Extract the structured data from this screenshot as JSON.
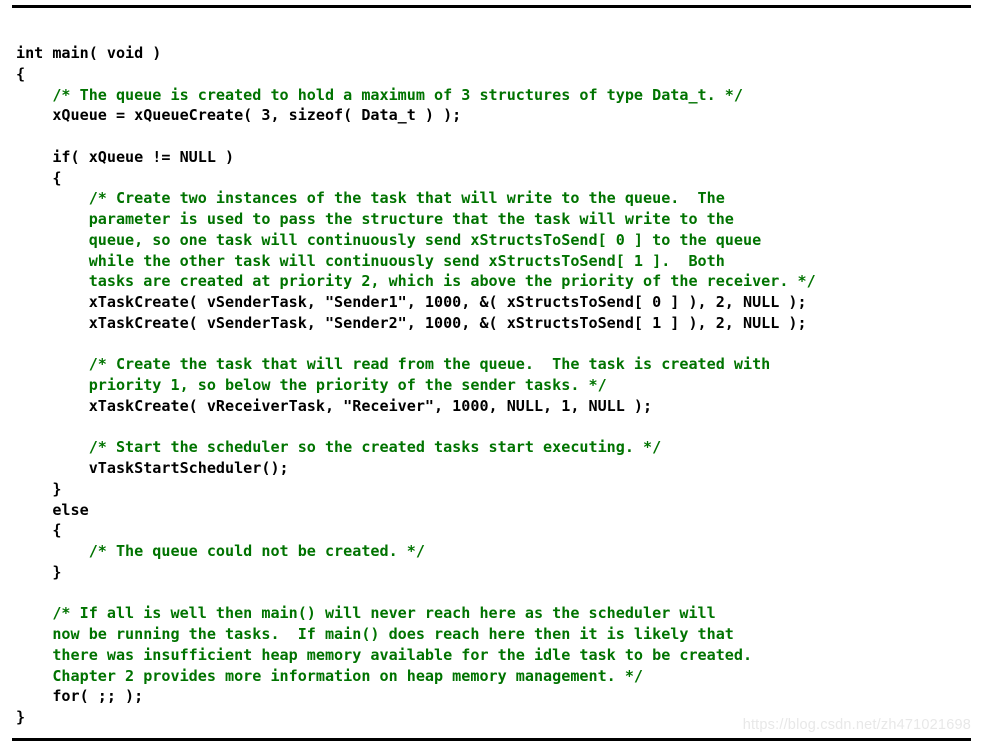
{
  "document": {
    "kind": "code-listing",
    "language": "c",
    "colors": {
      "background": "#ffffff",
      "code_text": "#000000",
      "comment_text": "#007300",
      "rule": "#000000",
      "watermark": "#e8e8e8"
    }
  },
  "watermark": {
    "text": "https://blog.csdn.net/zh471021698"
  },
  "code": {
    "lines": [
      {
        "indent": "",
        "segments": [
          {
            "type": "code",
            "text": "int main( void )"
          }
        ]
      },
      {
        "indent": "",
        "segments": [
          {
            "type": "code",
            "text": "{"
          }
        ]
      },
      {
        "indent": "    ",
        "segments": [
          {
            "type": "comment",
            "text": "/* The queue is created to hold a maximum of 3 structures of type Data_t. */"
          }
        ]
      },
      {
        "indent": "    ",
        "segments": [
          {
            "type": "code",
            "text": "xQueue = xQueueCreate( 3, sizeof( Data_t ) );"
          }
        ]
      },
      {
        "indent": "",
        "segments": []
      },
      {
        "indent": "    ",
        "segments": [
          {
            "type": "code",
            "text": "if( xQueue != NULL )"
          }
        ]
      },
      {
        "indent": "    ",
        "segments": [
          {
            "type": "code",
            "text": "{"
          }
        ]
      },
      {
        "indent": "        ",
        "segments": [
          {
            "type": "comment",
            "text": "/* Create two instances of the task that will write to the queue.  The"
          }
        ]
      },
      {
        "indent": "        ",
        "segments": [
          {
            "type": "comment",
            "text": "parameter is used to pass the structure that the task will write to the"
          }
        ]
      },
      {
        "indent": "        ",
        "segments": [
          {
            "type": "comment",
            "text": "queue, so one task will continuously send xStructsToSend[ 0 ] to the queue"
          }
        ]
      },
      {
        "indent": "        ",
        "segments": [
          {
            "type": "comment",
            "text": "while the other task will continuously send xStructsToSend[ 1 ].  Both"
          }
        ]
      },
      {
        "indent": "        ",
        "segments": [
          {
            "type": "comment",
            "text": "tasks are created at priority 2, which is above the priority of the receiver. */"
          }
        ]
      },
      {
        "indent": "        ",
        "segments": [
          {
            "type": "code",
            "text": "xTaskCreate( vSenderTask, \"Sender1\", 1000, &( xStructsToSend[ 0 ] ), 2, NULL );"
          }
        ]
      },
      {
        "indent": "        ",
        "segments": [
          {
            "type": "code",
            "text": "xTaskCreate( vSenderTask, \"Sender2\", 1000, &( xStructsToSend[ 1 ] ), 2, NULL );"
          }
        ]
      },
      {
        "indent": "",
        "segments": []
      },
      {
        "indent": "        ",
        "segments": [
          {
            "type": "comment",
            "text": "/* Create the task that will read from the queue.  The task is created with"
          }
        ]
      },
      {
        "indent": "        ",
        "segments": [
          {
            "type": "comment",
            "text": "priority 1, so below the priority of the sender tasks. */"
          }
        ]
      },
      {
        "indent": "        ",
        "segments": [
          {
            "type": "code",
            "text": "xTaskCreate( vReceiverTask, \"Receiver\", 1000, NULL, 1, NULL );"
          }
        ]
      },
      {
        "indent": "",
        "segments": []
      },
      {
        "indent": "        ",
        "segments": [
          {
            "type": "comment",
            "text": "/* Start the scheduler so the created tasks start executing. */"
          }
        ]
      },
      {
        "indent": "        ",
        "segments": [
          {
            "type": "code",
            "text": "vTaskStartScheduler();"
          }
        ]
      },
      {
        "indent": "    ",
        "segments": [
          {
            "type": "code",
            "text": "}"
          }
        ]
      },
      {
        "indent": "    ",
        "segments": [
          {
            "type": "code",
            "text": "else"
          }
        ]
      },
      {
        "indent": "    ",
        "segments": [
          {
            "type": "code",
            "text": "{"
          }
        ]
      },
      {
        "indent": "        ",
        "segments": [
          {
            "type": "comment",
            "text": "/* The queue could not be created. */"
          }
        ]
      },
      {
        "indent": "    ",
        "segments": [
          {
            "type": "code",
            "text": "}"
          }
        ]
      },
      {
        "indent": "",
        "segments": []
      },
      {
        "indent": "    ",
        "segments": [
          {
            "type": "comment",
            "text": "/* If all is well then main() will never reach here as the scheduler will"
          }
        ]
      },
      {
        "indent": "    ",
        "segments": [
          {
            "type": "comment",
            "text": "now be running the tasks.  If main() does reach here then it is likely that"
          }
        ]
      },
      {
        "indent": "    ",
        "segments": [
          {
            "type": "comment",
            "text": "there was insufficient heap memory available for the idle task to be created."
          }
        ]
      },
      {
        "indent": "    ",
        "segments": [
          {
            "type": "comment",
            "text": "Chapter 2 provides more information on heap memory management. */"
          }
        ]
      },
      {
        "indent": "    ",
        "segments": [
          {
            "type": "code",
            "text": "for( ;; );"
          }
        ]
      },
      {
        "indent": "",
        "segments": [
          {
            "type": "code",
            "text": "}"
          }
        ]
      }
    ]
  }
}
